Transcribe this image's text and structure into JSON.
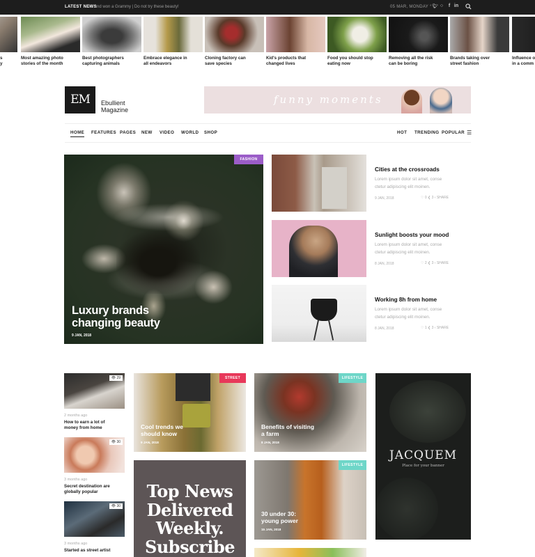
{
  "topbar": {
    "latest_label": "LATEST NEWS",
    "ticker": "ist and won a Grammy | Do not try these beauty!",
    "date": "05 MAR, MONDAY ° C",
    "social": [
      "twitter-icon",
      "instagram-icon",
      "facebook-icon",
      "linkedin-icon"
    ],
    "search_icon": "search-icon"
  },
  "strip": [
    {
      "caption": "s\ny"
    },
    {
      "caption": "Most amazing photo\nstories of the month"
    },
    {
      "caption": "Best photographers\ncapturing animals"
    },
    {
      "caption": "Embrace elegance in\nall endeavors"
    },
    {
      "caption": "Cloning factory can\nsave species"
    },
    {
      "caption": "Kid's products that\nchanged lives"
    },
    {
      "caption": "Food you should stop\neating now"
    },
    {
      "caption": "Removing all the risk\ncan be boring"
    },
    {
      "caption": "Brands taking over\nstreet fashion"
    },
    {
      "caption": "Influence o\nin a comm"
    }
  ],
  "brand": {
    "logo": "EM",
    "name_line1": "Ebullient",
    "name_line2": "Magazine"
  },
  "ad": {
    "text": "funny moments"
  },
  "nav": {
    "left": [
      "HOME",
      "FEATURES",
      "PAGES",
      "NEW",
      "VIDEO",
      "WORLD",
      "SHOP"
    ],
    "right": [
      "HOT",
      "TRENDING",
      "POPULAR"
    ],
    "menu_icon": "hamburger-menu-icon"
  },
  "hero": {
    "tag": "FASHION",
    "title_line1": "Luxury brands",
    "title_line2": "changing beauty",
    "date": "9 JAN, 2018"
  },
  "side_posts": [
    {
      "title": "Cities at the crossroads",
      "excerpt": "Lorem ipsum dolor sit amet, conse ctetur adipiscing elit moinen.",
      "date": "9 JAN, 2018",
      "stats": "♡ 0   ❮ 3   ‹ SHARE"
    },
    {
      "title": "Sunlight boosts your mood",
      "excerpt": "Lorem ipsum dolor sit amet, conse ctetur adipiscing elit moinen.",
      "date": "8 JAN, 2018",
      "stats": "♡ 2   ❮ 3   ‹ SHARE"
    },
    {
      "title": "Working 8h from home",
      "excerpt": "Lorem ipsum dolor sit amet, conse ctetur adipiscing elit moinen.",
      "date": "8 JAN, 2018",
      "stats": "♡ 1   ❮ 3   ‹ SHARE"
    }
  ],
  "small_posts": [
    {
      "views": "29",
      "ago": "2 months ago",
      "title": "How to earn a lot of\nmoney from home"
    },
    {
      "views": "30",
      "ago": "3 months ago",
      "title": "Secret destination are\nglobally popular"
    },
    {
      "views": "30",
      "ago": "3 months ago",
      "title": "Started as street artist"
    }
  ],
  "cards": [
    {
      "tag": "STREET",
      "title": "Cool trends we\nshould know",
      "date": "9 JAN, 2018"
    },
    {
      "tag": "LIFESTYLE",
      "title": "Benefits of visiting\na farm",
      "date": "8 JAN, 2018"
    },
    {
      "tag": "LIFESTYLE",
      "title": "30 under 30:\nyoung power",
      "date": "15 JAN, 2018"
    }
  ],
  "newsletter": {
    "text": "Top News Delivered Weekly. Subscribe"
  },
  "banner": {
    "title": "JACQUEM",
    "subtitle": "Place for your banner"
  },
  "colors": {
    "fashion": "#9b5dc8",
    "street": "#e8385a",
    "lifestyle": "#6ed6c8",
    "dark": "#1d1d1d"
  }
}
